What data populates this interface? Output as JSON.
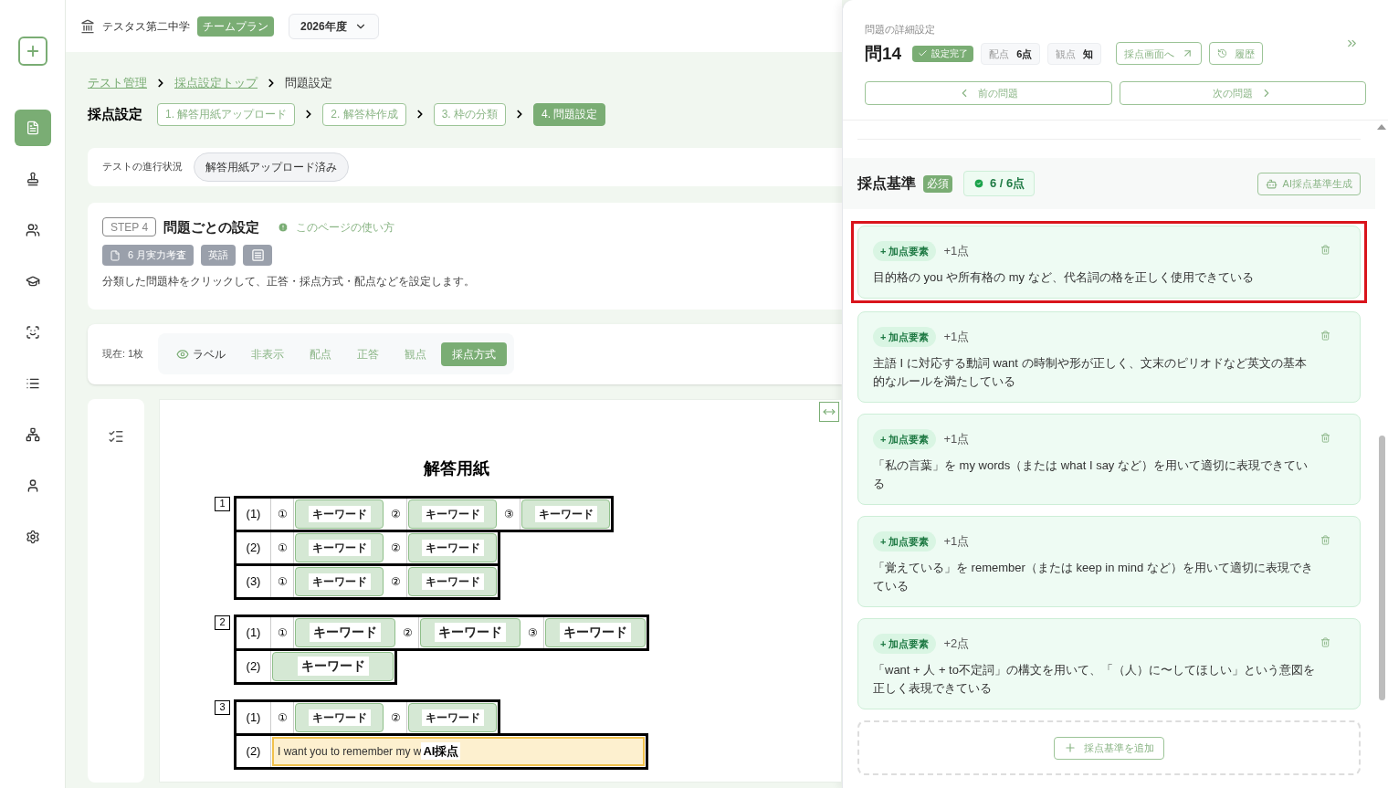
{
  "sidebar": {
    "items": [
      {
        "kind": "new",
        "selected": false
      },
      {
        "kind": "document",
        "selected": true
      },
      {
        "kind": "stamp",
        "selected": false
      },
      {
        "kind": "group",
        "selected": false
      },
      {
        "kind": "graduate",
        "selected": false
      },
      {
        "kind": "scan",
        "selected": false
      },
      {
        "kind": "list",
        "selected": false
      },
      {
        "kind": "hierarchy",
        "selected": false
      },
      {
        "kind": "user",
        "selected": false
      },
      {
        "kind": "settings",
        "selected": false
      }
    ]
  },
  "header": {
    "school": "テスタス第二中学",
    "plan": "チームプラン",
    "year": "2026年度"
  },
  "breadcrumb": [
    {
      "label": "テスト管理",
      "link": true
    },
    {
      "label": "採点設定トップ",
      "link": true
    },
    {
      "label": "問題設定",
      "link": false
    }
  ],
  "steps": {
    "title": "採点設定",
    "items": [
      {
        "label": "1. 解答用紙アップロード",
        "selected": false
      },
      {
        "label": "2. 解答枠作成",
        "selected": false
      },
      {
        "label": "3. 枠の分類",
        "selected": false
      },
      {
        "label": "4. 問題設定",
        "selected": true
      }
    ]
  },
  "progress": {
    "label": "テストの進行状況",
    "status": "解答用紙アップロード済み"
  },
  "step_card": {
    "step": "STEP 4",
    "title": "問題ごとの設定",
    "help": "このページの使い方",
    "tags": [
      "6 月実力考査",
      "英語"
    ],
    "description": "分類した問題枠をクリックして、正答・採点方式・配点などを設定します。"
  },
  "view_bar": {
    "current": "現在: 1枚",
    "items": [
      {
        "label": "ラベル",
        "kind": "toggle",
        "on": true
      },
      {
        "label": "非表示",
        "kind": "tab",
        "selected": false
      },
      {
        "label": "配点",
        "kind": "tab",
        "selected": false
      },
      {
        "label": "正答",
        "kind": "tab",
        "selected": false
      },
      {
        "label": "観点",
        "kind": "tab",
        "selected": false
      },
      {
        "label": "採点方式",
        "kind": "tab",
        "selected": true
      }
    ]
  },
  "sheet": {
    "title": "解答用紙",
    "sections": [
      {
        "number": "1",
        "rows": [
          {
            "label": "(1)",
            "items": [
              {
                "kind": "keyword",
                "marker": "①",
                "text": "キーワード"
              },
              {
                "kind": "keyword",
                "marker": "②",
                "text": "キーワード"
              },
              {
                "kind": "keyword",
                "marker": "③",
                "text": "キーワード"
              }
            ]
          },
          {
            "label": "(2)",
            "items": [
              {
                "kind": "keyword",
                "marker": "①",
                "text": "キーワード"
              },
              {
                "kind": "keyword",
                "marker": "②",
                "text": "キーワード"
              }
            ]
          },
          {
            "label": "(3)",
            "items": [
              {
                "kind": "keyword",
                "marker": "①",
                "text": "キーワード"
              },
              {
                "kind": "keyword",
                "marker": "②",
                "text": "キーワード"
              }
            ]
          }
        ]
      },
      {
        "number": "2",
        "rows": [
          {
            "label": "(1)",
            "items": [
              {
                "kind": "wide_keyword",
                "marker": "①",
                "text": "キーワード"
              },
              {
                "kind": "wide_keyword",
                "marker": "②",
                "text": "キーワード"
              },
              {
                "kind": "wide_keyword",
                "marker": "③",
                "text": "キーワード"
              }
            ]
          },
          {
            "label": "(2)",
            "items": [
              {
                "kind": "span_keyword",
                "text": "キーワード"
              }
            ]
          }
        ]
      },
      {
        "number": "3",
        "rows": [
          {
            "label": "(1)",
            "items": [
              {
                "kind": "keyword",
                "marker": "①",
                "text": "キーワード"
              },
              {
                "kind": "keyword",
                "marker": "②",
                "text": "キーワード"
              }
            ]
          },
          {
            "label": "(2)",
            "items": [
              {
                "kind": "answer",
                "text": "I want you to remember my w",
                "badge": "AI採点"
              }
            ]
          }
        ]
      }
    ]
  },
  "detail": {
    "caption": "問題の詳細設定",
    "question": "問14",
    "status": "設定完了",
    "chips": [
      {
        "label": "配点",
        "value": "6点"
      },
      {
        "label": "観点",
        "value": "知"
      }
    ],
    "open_grading": "採点画面へ",
    "history": "履歴",
    "prev": "前の問題",
    "next": "次の問題"
  },
  "criteria": {
    "title": "採点基準",
    "required": "必須",
    "total": "6 / 6点",
    "ai_button": "AI採点基準生成",
    "add": "採点基準を追加",
    "items": [
      {
        "tag": "+ 加点要素",
        "points": "+1点",
        "text": "目的格の you や所有格の my など、代名詞の格を正しく使用できている",
        "highlighted": true
      },
      {
        "tag": "+ 加点要素",
        "points": "+1点",
        "text": "主語 I に対応する動詞 want の時制や形が正しく、文末のピリオドなど英文の基本的なルールを満たしている",
        "highlighted": false
      },
      {
        "tag": "+ 加点要素",
        "points": "+1点",
        "text": "「私の言葉」を my words（または what I say など）を用いて適切に表現できている",
        "highlighted": false
      },
      {
        "tag": "+ 加点要素",
        "points": "+1点",
        "text": "「覚えている」を remember（または keep in mind など）を用いて適切に表現できている",
        "highlighted": false
      },
      {
        "tag": "+ 加点要素",
        "points": "+2点",
        "text": "「want + 人 + to不定詞」の構文を用いて、「（人）に〜してほしい」という意図を正しく表現できている",
        "highlighted": false
      }
    ]
  }
}
